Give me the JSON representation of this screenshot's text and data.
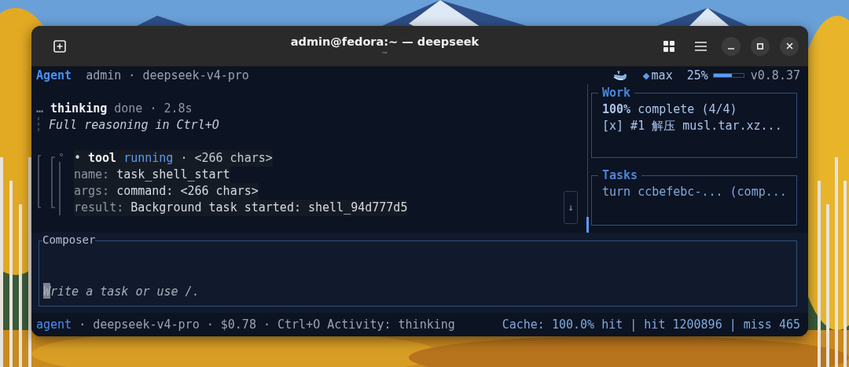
{
  "window": {
    "title": "admin@fedora:~ — deepseek",
    "subtitle": "~"
  },
  "header": {
    "mode": "Agent",
    "context": "admin · deepseek-v4-pro",
    "effort_glyph": "◆",
    "effort": "max",
    "usage": "25%",
    "meter": {
      "level": 0.6
    },
    "version": "v0.8.37"
  },
  "transcript": [
    {
      "kind": "thinking",
      "prefix": "…",
      "title": "thinking",
      "status": "done · 2.8s",
      "detail": "Full reasoning in Ctrl+O"
    },
    {
      "kind": "tool",
      "bullet": "•",
      "title": "tool",
      "status": "running",
      "meta": "· <266 chars>",
      "fields": [
        {
          "key": "name:",
          "value": "task_shell_start"
        },
        {
          "key": "args:",
          "value": "command: <266 chars>"
        },
        {
          "key": "result:",
          "value": "Background task started: shell_94d777d5"
        }
      ]
    }
  ],
  "scroll_button": "↓",
  "sidebar": [
    {
      "title": "Work",
      "lines": [
        "**100%** complete (4/4)",
        "[x] #1 解压 musl.tar.xz..."
      ]
    },
    {
      "title": "Tasks",
      "lines": [
        "turn ccbefebc-... (comp..."
      ]
    }
  ],
  "composer": {
    "title": "Composer",
    "placeholder": "Write a task or use /."
  },
  "status_bar": {
    "mode": "agent",
    "info": "· deepseek-v4-pro · $0.78 · Ctrl+O Activity: thinking",
    "cache": "Cache: 100.0% hit | hit 1200896 | miss 465"
  }
}
